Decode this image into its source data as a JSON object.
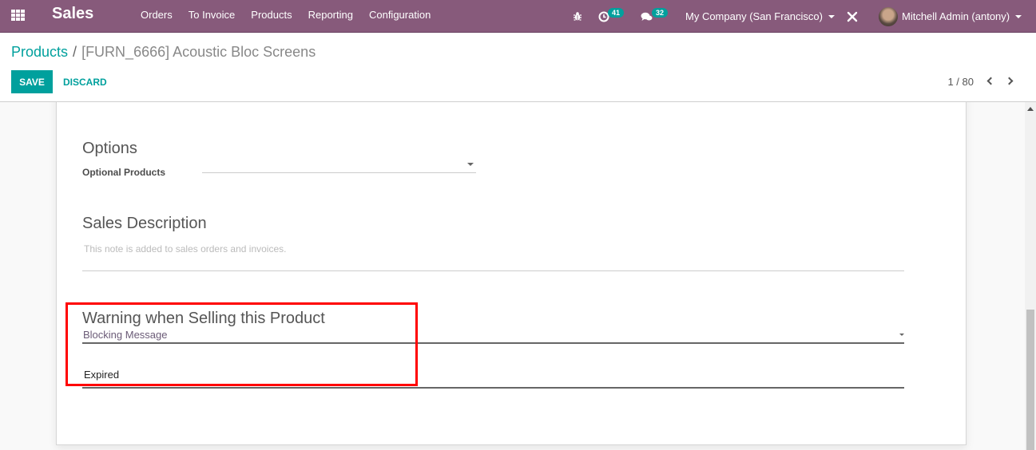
{
  "navbar": {
    "app_name": "Sales",
    "menu": [
      "Orders",
      "To Invoice",
      "Products",
      "Reporting",
      "Configuration"
    ],
    "activity_count": "41",
    "messages_count": "32",
    "company": "My Company (San Francisco)",
    "user": "Mitchell Admin (antony)",
    "icons": [
      "apps-grid-icon",
      "bug-icon",
      "clock-icon",
      "chat-icon",
      "tools-icon"
    ],
    "accent_color": "#875a7b",
    "badge_color": "#00a09d"
  },
  "control_panel": {
    "breadcrumb_parent": "Products",
    "breadcrumb_separator": "/",
    "breadcrumb_current": "[FURN_6666] Acoustic Bloc Screens",
    "save_label": "SAVE",
    "discard_label": "DISCARD",
    "pager": "1 / 80"
  },
  "form": {
    "options": {
      "title": "Options",
      "optional_products_label": "Optional Products",
      "optional_products_value": ""
    },
    "sales_description": {
      "title": "Sales Description",
      "placeholder": "This note is added to sales orders and invoices."
    },
    "warning": {
      "title": "Warning when Selling this Product",
      "type_value": "Blocking Message",
      "message_value": "Expired",
      "highlight_color": "#ff0000"
    }
  }
}
